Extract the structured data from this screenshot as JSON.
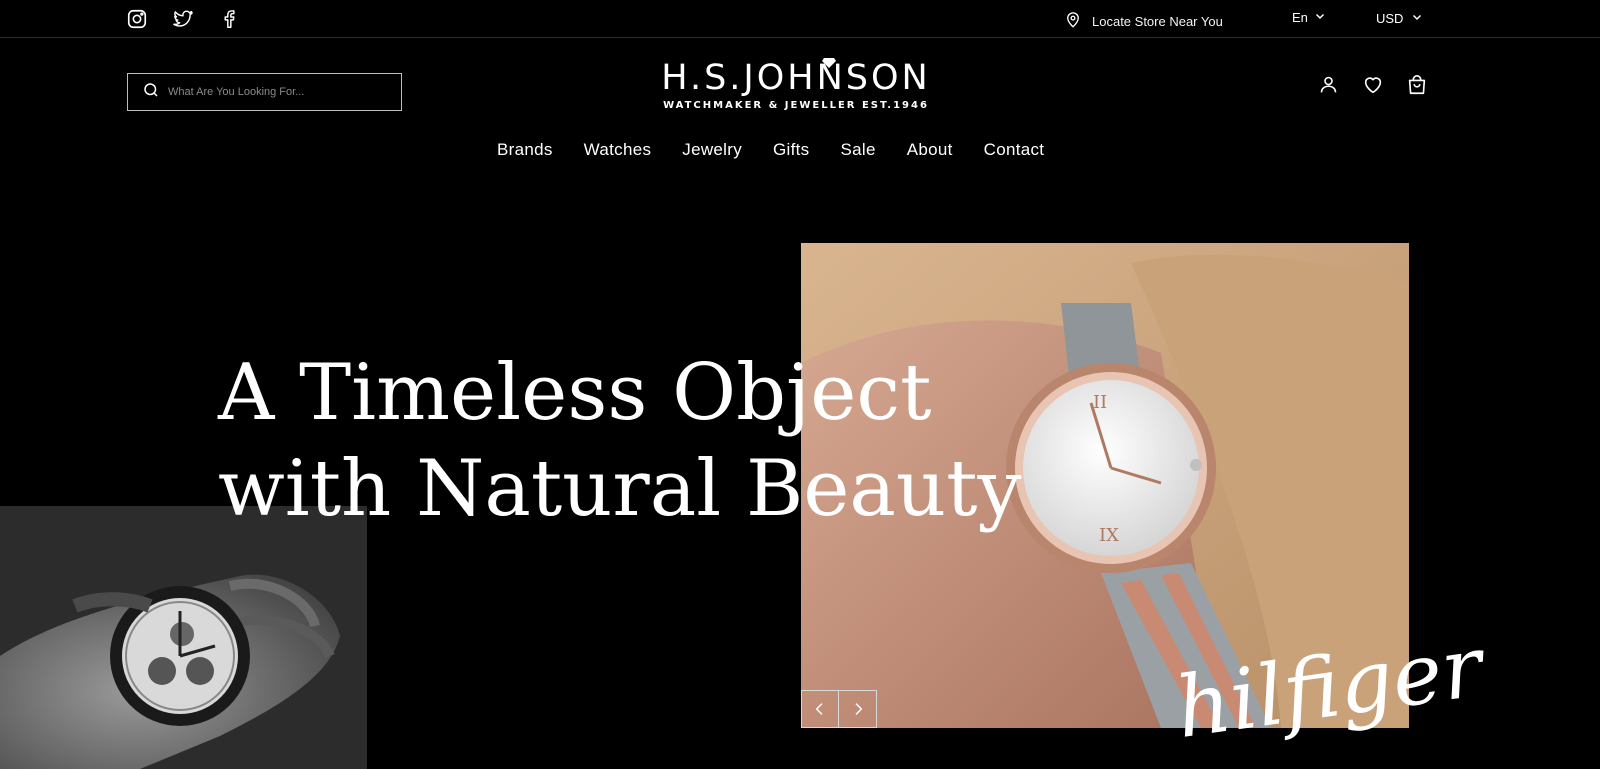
{
  "topbar": {
    "social": [
      "instagram-icon",
      "twitter-icon",
      "facebook-icon"
    ],
    "locate_label": "Locate Store Near You",
    "language": "En",
    "currency": "USD"
  },
  "header": {
    "search_placeholder": "What Are You Looking For...",
    "logo_main": "H.S.JOHNSON",
    "logo_sub": "WATCHMAKER & JEWELLER EST.1946",
    "icons": [
      "user-icon",
      "heart-icon",
      "bag-icon"
    ]
  },
  "nav": [
    "Brands",
    "Watches",
    "Jewelry",
    "Gifts",
    "Sale",
    "About",
    "Contact"
  ],
  "hero": {
    "line1": "A Timeless Object",
    "line2": "with Natural Beauty",
    "brand_script": "hilfiger"
  },
  "colors": {
    "background": "#000000",
    "text": "#ffffff"
  }
}
